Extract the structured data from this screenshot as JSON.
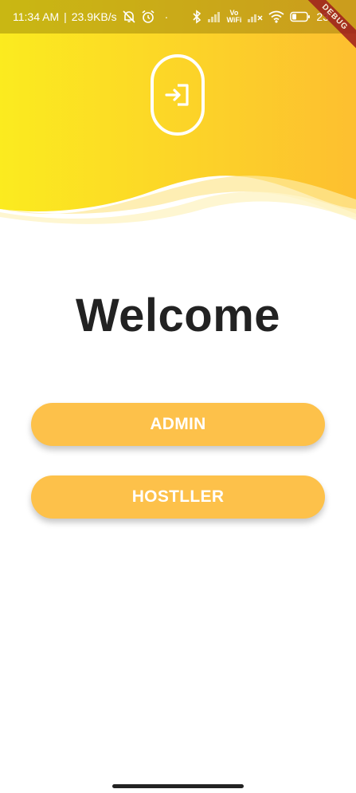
{
  "status_bar": {
    "time": "11:34 AM",
    "speed": "23.9KB/s",
    "dot": "·",
    "vowifi_top": "Vo",
    "vowifi_bottom": "WiFi",
    "battery_text": "23"
  },
  "debug_banner": {
    "label": "DEBUG"
  },
  "header": {
    "gradient_start": "#fbe61d",
    "gradient_end": "#fdc22f",
    "logo_icon": "login-icon"
  },
  "welcome": {
    "title": "Welcome"
  },
  "buttons": {
    "admin_label": "ADMIN",
    "hostller_label": "HOSTLLER",
    "color": "#fdc14a"
  }
}
